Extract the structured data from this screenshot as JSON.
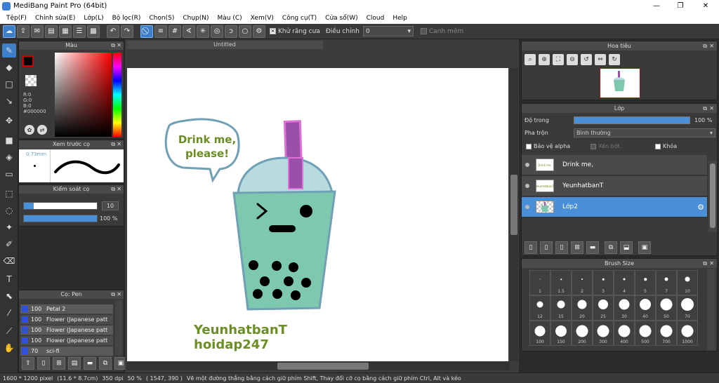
{
  "window": {
    "title": "MediBang Paint Pro (64bit)",
    "minimize": "—",
    "maximize": "❐",
    "close": "✕"
  },
  "menu": [
    "Tệp(F)",
    "Chỉnh sửa(E)",
    "Lớp(L)",
    "Bộ lọc(R)",
    "Chọn(S)",
    "Chụp(N)",
    "Màu (C)",
    "Xem(V)",
    "Công cụ(T)",
    "Cửa sổ(W)",
    "Cloud",
    "Help"
  ],
  "toolbar": {
    "antialias_label": "Khử răng cưa",
    "correction_label": "Điều chỉnh",
    "correction_value": "0",
    "edge_label": "Canh mềm"
  },
  "color_panel": {
    "title": "Màu",
    "r": "R:0",
    "g": "G:0",
    "b": "B:0",
    "hex": "#000000"
  },
  "brush_preview": {
    "title": "Xem trước cọ",
    "size": "0.73mm"
  },
  "brush_control": {
    "title": "Kiểm soát cọ",
    "size_value": "10",
    "opacity_value": "100 %",
    "size_fraction": 0.13,
    "opacity_fraction": 1.0
  },
  "brush_list": {
    "title": "Cọ: Pen",
    "items": [
      {
        "size": "100",
        "name": "Petal 2"
      },
      {
        "size": "100",
        "name": "Flower (Japanese patt"
      },
      {
        "size": "100",
        "name": "Flower (Japanese patt"
      },
      {
        "size": "100",
        "name": "Flower (Japanese patt"
      },
      {
        "size": "70",
        "name": "sci-fi"
      }
    ]
  },
  "document": {
    "tab_title": "Untitled",
    "speech_line1": "Drink me,",
    "speech_line2": "please!",
    "signature_line1": "YeunhatbanT",
    "signature_line2": "hoidap247"
  },
  "navigator": {
    "title": "Hoa tiêu"
  },
  "layer_panel": {
    "title": "Lớp",
    "opacity_label": "Độ trong",
    "opacity_value": "100 %",
    "blend_label": "Pha trộn",
    "blend_value": "Bình thường",
    "protect_alpha": "Bảo vệ alpha",
    "clipping": "Xén bớt",
    "lock": "Khóa",
    "layers": [
      {
        "name": "Drink me,",
        "thumb": "Drink me,"
      },
      {
        "name": "YeunhatbanT",
        "thumb": "YeunhatbanT"
      },
      {
        "name": "Lớp2",
        "thumb": ""
      }
    ],
    "selected_index": 2
  },
  "brush_size_panel": {
    "title": "Brush Size",
    "sizes": [
      "1",
      "1.5",
      "2",
      "3",
      "4",
      "5",
      "7",
      "10",
      "12",
      "15",
      "20",
      "25",
      "30",
      "40",
      "50",
      "70",
      "100",
      "150",
      "200",
      "300",
      "400",
      "500",
      "700",
      "1000"
    ]
  },
  "status": {
    "image_size": "1600 * 1200 pixel",
    "physical_size": "(11.6 * 8.7cm)",
    "dpi": "350 dpi",
    "zoom": "50 %",
    "cursor": "( 1547, 390 )",
    "hint": "Vẽ một đường thẳng bằng cách giữ phím Shift, Thay đổi cỡ cọ bằng cách giữ phím Ctrl, Alt và kéo"
  },
  "colors": {
    "accent": "#4a90d9",
    "cup_body": "#7ec8b0",
    "cup_lid": "#b8dbe0",
    "straw": "#9a4fa8",
    "straw_outline": "#e070d8",
    "outline": "#6fa0b5",
    "text_green": "#6b8e23"
  }
}
